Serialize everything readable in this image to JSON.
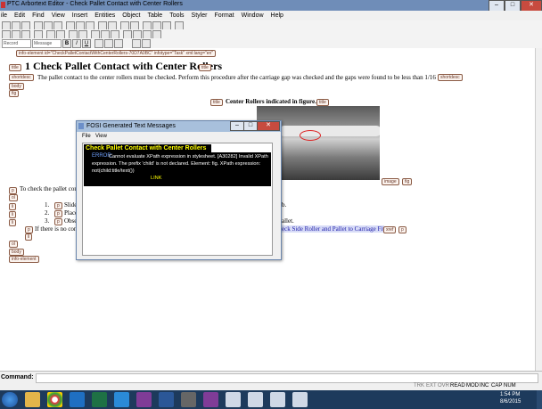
{
  "window": {
    "title": "PTC Arbortext Editor - Check Pallet Contact with Center Rollers"
  },
  "menu": [
    "ile",
    "Edit",
    "Find",
    "View",
    "Insert",
    "Entities",
    "Object",
    "Table",
    "Tools",
    "Styler",
    "Format",
    "Window",
    "Help"
  ],
  "toolbar": {
    "style_combo": "Record",
    "size_combo": "Message"
  },
  "doc": {
    "root_tag": "info-element id=\"CheckPalletContactWithCenterRollers-70D7A0BC\" infotype=\"Task\" xml:lang=\"en\"",
    "title_tag": "title",
    "heading": "1 Check Pallet Contact with Center Rollers",
    "shortdesc_tag": "shortdesc",
    "shortdesc_text": "The pallet contact to the center rollers must be checked. Perform this procedure after the carriage gap was checked and the gaps were found to be less than 1/16 in.",
    "body_tag": "body",
    "fig_tag": "fig",
    "fig_title": "Center Rollers indicated in figure.",
    "image_tag": "image",
    "p_tag": "p",
    "ol_tag": "ol",
    "li_tag": "li",
    "para_intro": "To check the pallet con",
    "steps": [
      "Slide",
      "Place",
      "Obse"
    ],
    "step_tail_1": "b.",
    "step_tail_3": "allet.",
    "if_text": "If there is no con",
    "xref_text": "eck Side Roller and Pallet to Carriage Fit",
    "xref_tag": "xref"
  },
  "dialog": {
    "title": "FOSI Generated Text Messages",
    "menu": [
      "File",
      "View"
    ],
    "heading": "Check Pallet Contact with Center Rollers",
    "error_label": "ERROR:",
    "error_text": "Cannot evaluate XPath expression in stylesheet. [A30282] Invalid XPath expression. The prefix 'child' is not declared. Element: fig.  XPath expression: not(child:title/text())",
    "link": "LINK"
  },
  "command": {
    "label": "Command:"
  },
  "status": [
    "TRK",
    "EXT",
    "OVR",
    "READ",
    "MOD",
    "INC",
    "CAP",
    "NUM"
  ],
  "clock": {
    "time": "1:54 PM",
    "date": "8/6/2015"
  },
  "taskbar_apps": [
    "file-explorer-icon",
    "chrome-icon",
    "outlook-icon",
    "excel-icon",
    "lync-icon",
    "onenote-icon",
    "word-icon",
    "calculator-icon",
    "onenote-icon-2",
    "arbortext-icon-1",
    "arbortext-icon-2",
    "arbortext-icon-3",
    "arbortext-icon-4"
  ]
}
